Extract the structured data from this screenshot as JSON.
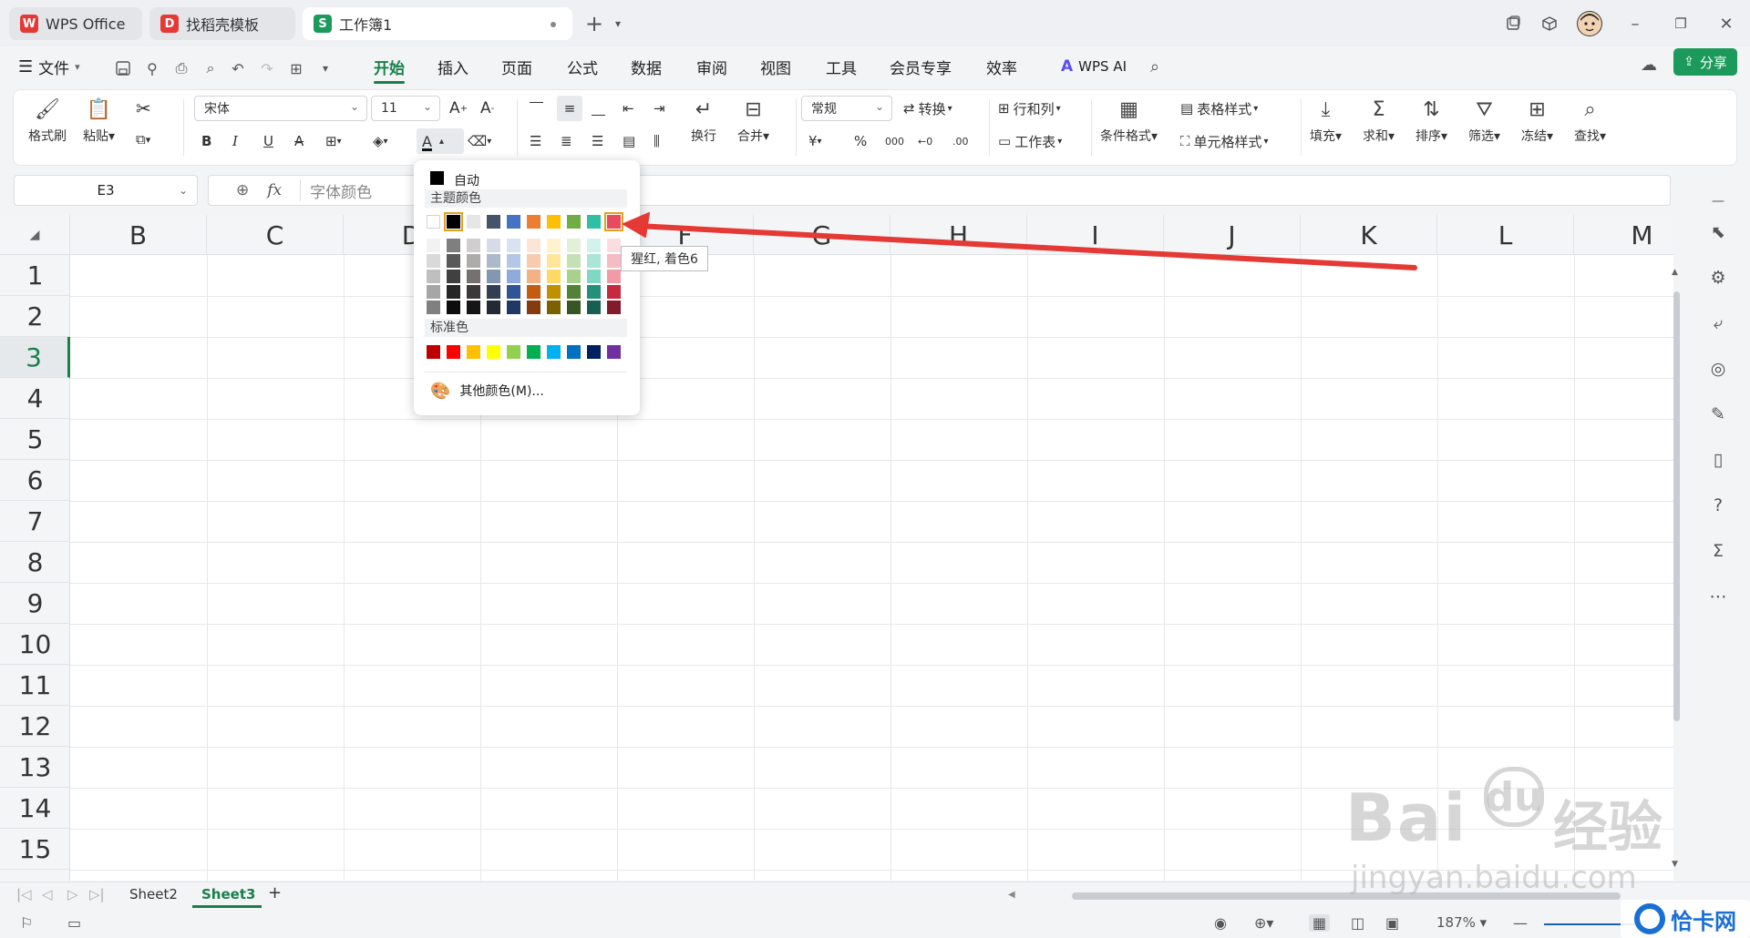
{
  "tabs": [
    {
      "label": "WPS Office",
      "logo": "W",
      "color": "#e53935"
    },
    {
      "label": "找稻壳模板",
      "logo": "D",
      "color": "#e53935"
    },
    {
      "label": "工作簿1",
      "logo": "S",
      "color": "#1c9a5b"
    }
  ],
  "menubar": {
    "file_label": "文件",
    "items": [
      "开始",
      "插入",
      "页面",
      "公式",
      "数据",
      "审阅",
      "视图",
      "工具",
      "会员专享",
      "效率"
    ],
    "active": "开始",
    "wps_ai": "WPS AI",
    "share": "分享"
  },
  "ribbon": {
    "format_painter": "格式刷",
    "paste": "粘贴",
    "font_name": "宋体",
    "font_size": "11",
    "wrap": "换行",
    "merge": "合并",
    "number_format": "常规",
    "convert": "转换",
    "rows_cols": "行和列",
    "worksheet": "工作表",
    "cond_format": "条件格式",
    "table_style": "表格样式",
    "cell_style": "单元格样式",
    "fill": "填充",
    "sum": "求和",
    "sort": "排序",
    "filter": "筛选",
    "freeze": "冻结",
    "find": "查找",
    "bold": "B",
    "italic": "I",
    "underline": "U",
    "strike": "A",
    "font_color": "A",
    "currency": "¥",
    "percent": "%",
    "thousands": "000",
    "dec_inc": "←0",
    "dec_dec": ".00"
  },
  "formula": {
    "cell_ref": "E3",
    "fx": "fx",
    "content": "字体颜色"
  },
  "grid": {
    "columns": [
      "B",
      "C",
      "D",
      "E",
      "F",
      "G",
      "H",
      "I",
      "J",
      "K",
      "L",
      "M"
    ],
    "rows": [
      "1",
      "2",
      "3",
      "4",
      "5",
      "6",
      "7",
      "8",
      "9",
      "10",
      "11",
      "12",
      "13",
      "14",
      "15"
    ],
    "selected_row": "3"
  },
  "sheets": {
    "tabs": [
      "Sheet2",
      "Sheet3"
    ],
    "active": "Sheet3"
  },
  "status": {
    "zoom": "187%"
  },
  "color_menu": {
    "auto_label": "自动",
    "theme_label": "主题颜色",
    "standard_label": "标准色",
    "more_label": "其他颜色(M)...",
    "tooltip": "猩红, 着色6",
    "theme_top": [
      "#ffffff",
      "#000000",
      "#e7e6e6",
      "#44546a",
      "#4472c4",
      "#ed7d31",
      "#ffc000",
      "#70ad47",
      "#2fbfa5",
      "#e84a5f"
    ],
    "theme_shades": [
      [
        "#f2f2f2",
        "#7f7f7f",
        "#d0cece",
        "#d6dce5",
        "#d9e2f3",
        "#fbe5d6",
        "#fff2cc",
        "#e2f0d9",
        "#d4f2ec",
        "#fbdde1"
      ],
      [
        "#d9d9d9",
        "#595959",
        "#aeabab",
        "#adb9ca",
        "#b4c7e7",
        "#f8cbad",
        "#ffe699",
        "#c5e0b4",
        "#a9e5d9",
        "#f6bcc4"
      ],
      [
        "#bfbfbf",
        "#404040",
        "#757171",
        "#8497b0",
        "#8faadc",
        "#f4b183",
        "#ffd966",
        "#a9d18e",
        "#7fd8c6",
        "#f29aa6"
      ],
      [
        "#a6a6a6",
        "#262626",
        "#3a3838",
        "#333f50",
        "#2f5597",
        "#c55a11",
        "#bf9000",
        "#538135",
        "#23907c",
        "#c52a3f"
      ],
      [
        "#808080",
        "#0d0d0d",
        "#171616",
        "#222a35",
        "#1f3864",
        "#843c0c",
        "#7f6000",
        "#375623",
        "#175f52",
        "#831c2a"
      ]
    ],
    "standard": [
      "#c00000",
      "#ff0000",
      "#ffc000",
      "#ffff00",
      "#92d050",
      "#00b050",
      "#00b0f0",
      "#0070c0",
      "#002060",
      "#7030a0"
    ]
  },
  "watermarks": {
    "baidu": "Bai",
    "du": "du",
    "jingyan_cn": "经验",
    "url": "jingyan.baidu.com",
    "site": "恰卡网"
  },
  "colors": {
    "accent": "#1a7f4b",
    "share_bg": "#1c9a5b",
    "arrow": "#e53935"
  }
}
